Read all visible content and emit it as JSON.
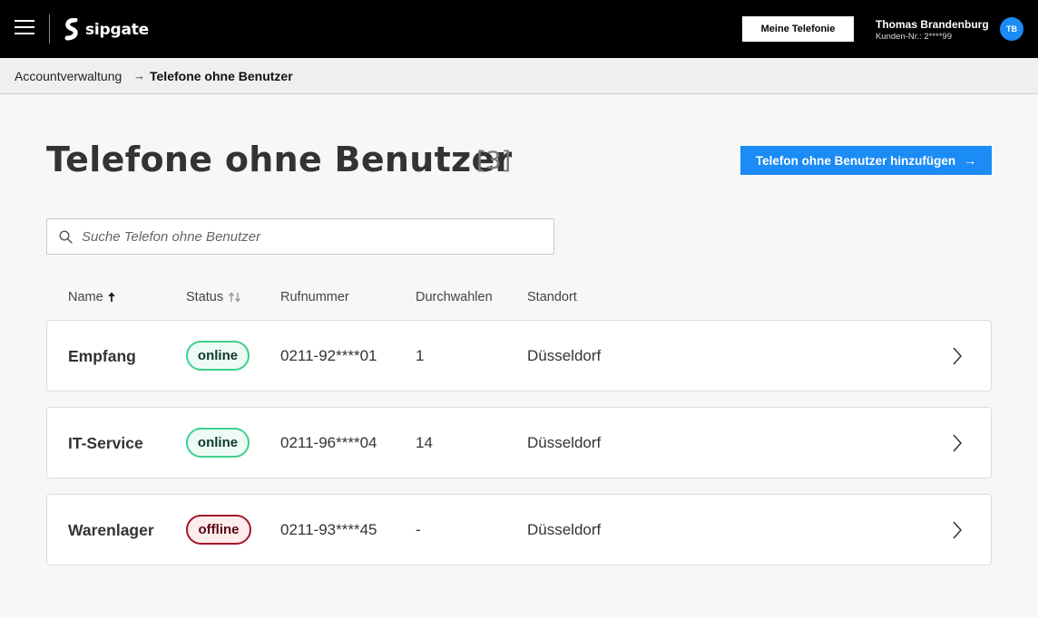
{
  "header": {
    "logo_text": "sipgate",
    "my_telephony_label": "Meine Telefonie",
    "user_name": "Thomas Brandenburg",
    "customer_number": "Kunden-Nr.: 2****99",
    "avatar_initials": "TB"
  },
  "breadcrumb": {
    "parent": "Accountverwaltung",
    "separator": "→",
    "current": "Telefone ohne Benutzer"
  },
  "page": {
    "title": "Telefone ohne Benutzer",
    "count": "[3]",
    "add_button_label": "Telefon ohne Benutzer hinzufügen",
    "add_button_arrow": "→"
  },
  "search": {
    "placeholder": "Suche Telefon ohne Benutzer",
    "value": ""
  },
  "table": {
    "columns": {
      "name": "Name",
      "status": "Status",
      "number": "Rufnummer",
      "extensions": "Durchwahlen",
      "location": "Standort"
    },
    "sort": {
      "column": "Name",
      "direction": "ascending"
    },
    "rows": [
      {
        "name": "Empfang",
        "status": "online",
        "number": "0211-92****01",
        "extensions": "1",
        "location": "Düsseldorf"
      },
      {
        "name": "IT-Service",
        "status": "online",
        "number": "0211-96****04",
        "extensions": "14",
        "location": "Düsseldorf"
      },
      {
        "name": "Warenlager",
        "status": "offline",
        "number": "0211-93****45",
        "extensions": "-",
        "location": "Düsseldorf"
      }
    ]
  },
  "colors": {
    "topbar": "#000000",
    "accent_blue": "#1b8bf5",
    "online_border": "#3ccf8e",
    "offline_border": "#a3162c",
    "page_background": "#f7f7f7"
  },
  "icons": {
    "menu": "hamburger-icon",
    "logo": "sipgate-logo-icon",
    "search": "search-icon",
    "sort_active": "arrow-up-icon",
    "sort_inactive": "sort-updown-icon",
    "row_action": "chevron-right-icon",
    "breadcrumb_separator": "arrow-right-icon"
  }
}
